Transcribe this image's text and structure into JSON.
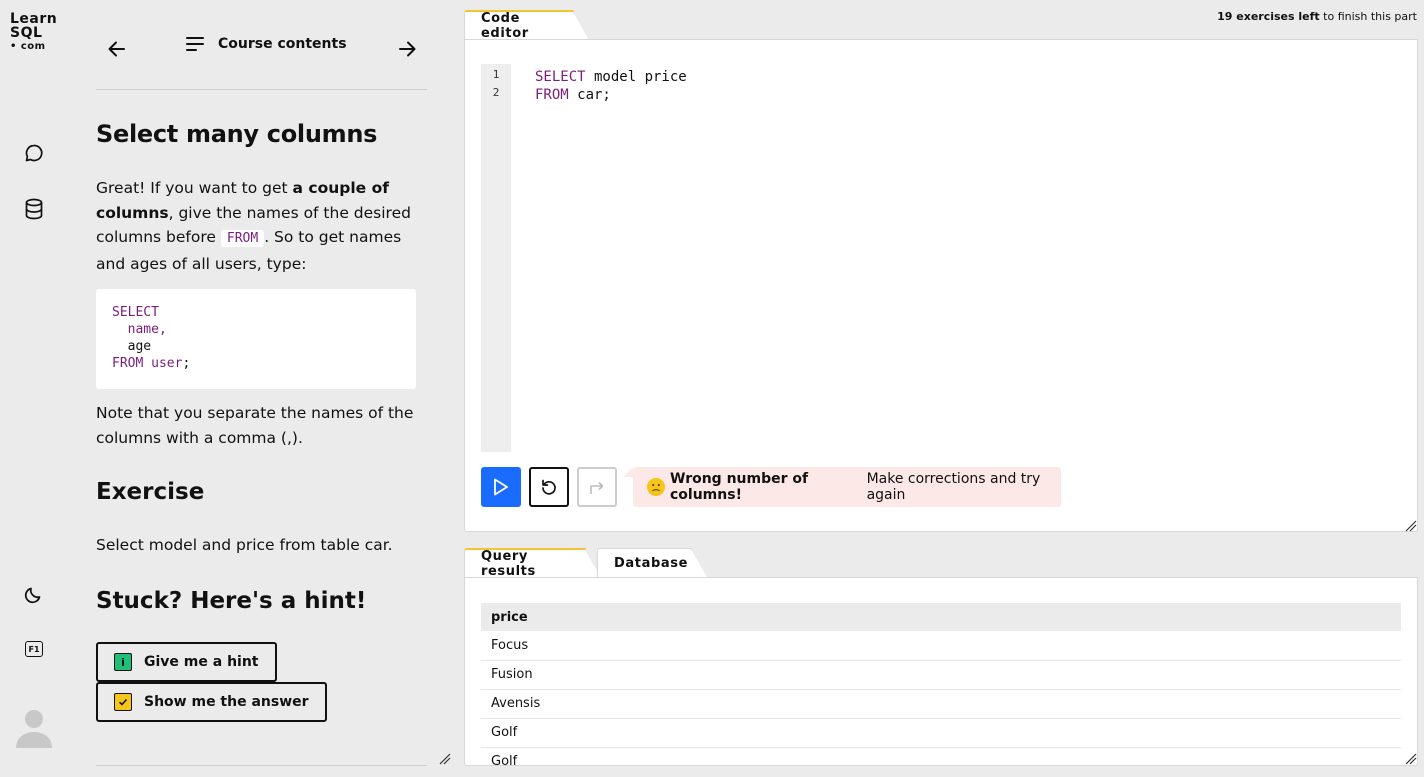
{
  "logo": {
    "line1": "Learn",
    "line2": "SQL",
    "line3": "• com"
  },
  "rail": {
    "icons": [
      "chat-icon",
      "database-icon",
      "moon-icon",
      "f1-icon"
    ],
    "f1_label": "F1"
  },
  "lesson": {
    "nav": {
      "contents_label": "Course contents"
    },
    "title": "Select many columns",
    "intro_start": "Great! If you want to get ",
    "intro_bold": "a couple of columns",
    "intro_mid": ", give the names of the desired columns before ",
    "intro_code": "FROM",
    "intro_end": ". So to get names and ages of all users, type:",
    "code_lines": {
      "l1": "SELECT",
      "l2": "  name,",
      "l3": "  age",
      "l4_kw": "FROM user",
      "l4_end": ";"
    },
    "note": "Note that you separate the names of the columns with a comma (,).",
    "exercise_heading": "Exercise",
    "exercise_text": "Select model and price from table car.",
    "stuck_heading": "Stuck? Here's a hint!",
    "hint_button": "Give me a hint",
    "hint_icon_char": "i",
    "answer_button": "Show me the answer"
  },
  "editor": {
    "tab_label": "Code editor",
    "progress_bold": "19 exercises left",
    "progress_rest": " to finish this part",
    "line_numbers": [
      "1",
      "2"
    ],
    "line1_kw": "SELECT",
    "line1_rest": " model price",
    "line2_kw": "FROM",
    "line2_rest": " car;",
    "feedback_bold": "Wrong number of columns!",
    "feedback_rest": "Make corrections and try again"
  },
  "results": {
    "tabs": [
      "Query results",
      "Database"
    ],
    "columns": [
      "price"
    ],
    "rows": [
      "Focus",
      "Fusion",
      "Avensis",
      "Golf",
      "Golf"
    ]
  },
  "colors": {
    "accent_blue": "#1a6cff",
    "keyword_purple": "#7a1e7a",
    "tab_yellow": "#f4c430",
    "error_bg": "#fde8e8",
    "hint_green": "#1fbf7a",
    "answer_yellow": "#f5c518"
  }
}
